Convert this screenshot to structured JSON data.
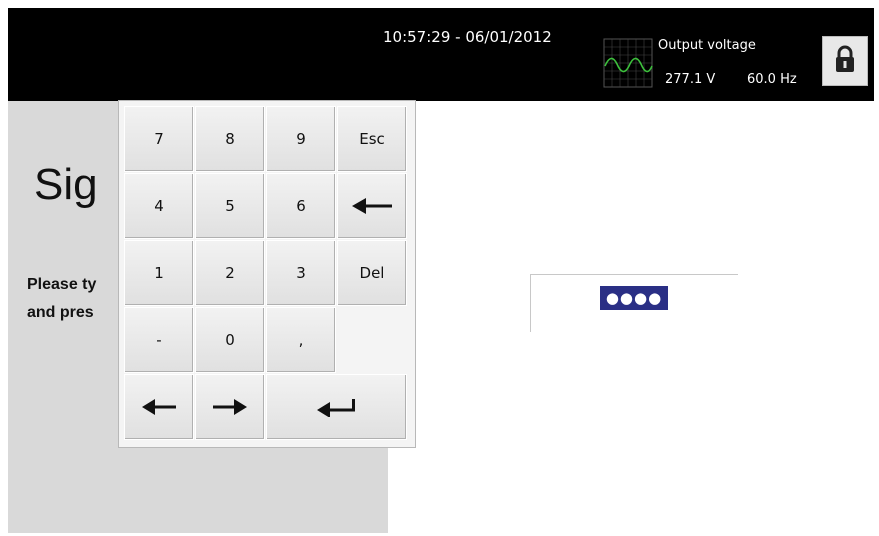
{
  "header": {
    "datetime": "10:57:29 - 06/01/2012",
    "output_label": "Output voltage",
    "voltage": "277.1 V",
    "frequency": "60.0 Hz"
  },
  "page": {
    "title": "Sig",
    "instruction_line1": "Please ty",
    "instruction_line2": "and pres"
  },
  "password": {
    "masked_value": "●●●●"
  },
  "keypad": {
    "keys": [
      "7",
      "8",
      "9",
      "Esc",
      "4",
      "5",
      "6",
      "1",
      "2",
      "3",
      "Del",
      "-",
      "0",
      ","
    ]
  },
  "icons": {
    "scope": "waveform-icon",
    "lock": "lock-icon",
    "backspace": "backspace-arrow-icon",
    "left": "left-arrow-icon",
    "right": "right-arrow-icon",
    "enter": "enter-icon"
  }
}
